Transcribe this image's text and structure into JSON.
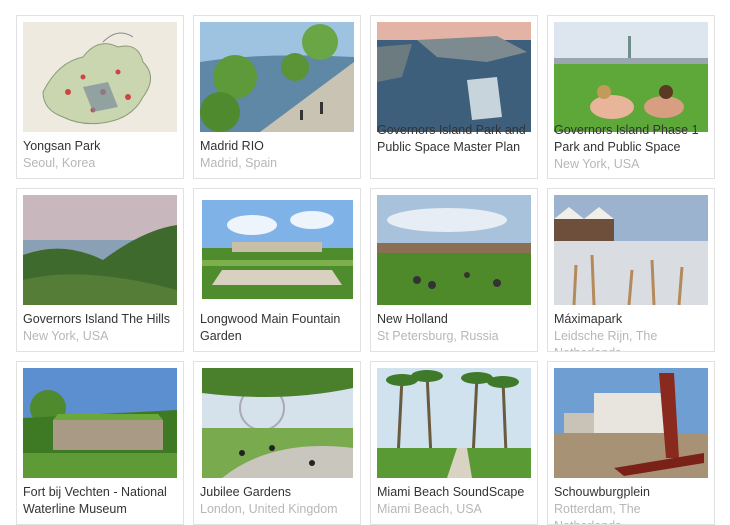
{
  "projects": [
    {
      "title": "Yongsan Park",
      "location": "Seoul, Korea"
    },
    {
      "title": "Madrid RIO",
      "location": "Madrid, Spain"
    },
    {
      "title": "Governors Island Park and Public Space Master Plan",
      "location": ""
    },
    {
      "title": "Governors Island Phase 1 Park and Public Space",
      "location": "New York, USA"
    },
    {
      "title": "Governors Island The Hills",
      "location": "New York, USA"
    },
    {
      "title": "Longwood Main Fountain Garden",
      "location": ""
    },
    {
      "title": "New Holland",
      "location": "St Petersburg, Russia"
    },
    {
      "title": "Máximapark",
      "location": "Leidsche Rijn, The Netherlands"
    },
    {
      "title": "Fort bij Vechten - National Waterline Museum",
      "location": ""
    },
    {
      "title": "Jubilee Gardens",
      "location": "London, United Kingdom"
    },
    {
      "title": "Miami Beach SoundScape",
      "location": "Miami Beach, USA"
    },
    {
      "title": "Schouwburgplein",
      "location": "Rotterdam, The Netherlands"
    }
  ]
}
